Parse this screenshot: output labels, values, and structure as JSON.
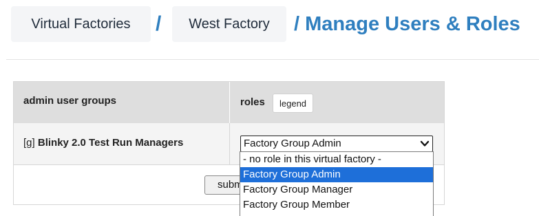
{
  "breadcrumb": {
    "items": [
      "Virtual Factories",
      "West Factory"
    ],
    "separator": "/",
    "current": "/ Manage Users & Roles"
  },
  "table": {
    "headers": {
      "groups": "admin user groups",
      "roles": "roles",
      "legend_button": "legend"
    },
    "rows": [
      {
        "prefix": "[g]",
        "group_name": "Blinky 2.0 Test Run Managers",
        "selected_role": "Factory Group Admin"
      }
    ],
    "submit_label": "submit"
  },
  "dropdown": {
    "options": [
      "- no role in this virtual factory -",
      "Factory Group Admin",
      "Factory Group Manager",
      "Factory Group Member"
    ],
    "selected_index": 1
  },
  "colors": {
    "accent": "#2f7fbf",
    "selected_option": "#1e6fd9",
    "header_bg": "#dedede",
    "row_bg": "#f4f4f4"
  },
  "icons": {
    "select_arrow": "chevron-down-icon"
  }
}
